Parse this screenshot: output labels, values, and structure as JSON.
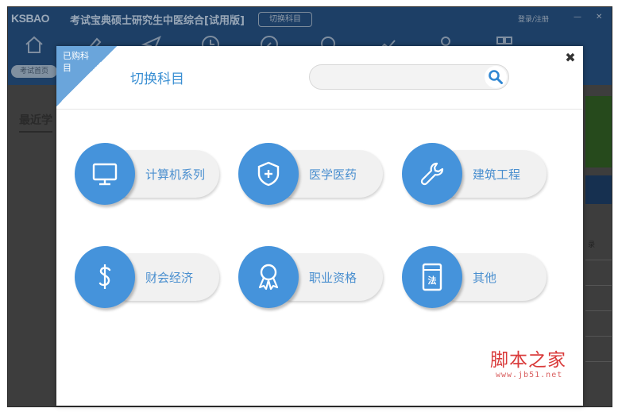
{
  "app": {
    "brand": "KSBAO",
    "brand_cn": "考试宝典",
    "title": "硕士研究生中医综合[试用版]",
    "switch_button": "切换科目",
    "login": "登录/注册",
    "home_tab": "考试首页",
    "recent_heading": "最近学",
    "right_fragment": "录"
  },
  "modal": {
    "corner_label": "已购科目",
    "title": "切换科目",
    "search": {
      "value": "",
      "placeholder": ""
    },
    "close_glyph": "✖",
    "categories": [
      {
        "label": "计算机系列",
        "icon": "monitor-icon"
      },
      {
        "label": "医学医药",
        "icon": "shield-plus-icon"
      },
      {
        "label": "建筑工程",
        "icon": "wrench-icon"
      },
      {
        "label": "财会经济",
        "icon": "dollar-icon"
      },
      {
        "label": "职业资格",
        "icon": "award-ribbon-icon"
      },
      {
        "label": "其他",
        "icon": "law-book-icon"
      }
    ],
    "icon_law_text": "法"
  },
  "watermark": {
    "cn": "脚本之家",
    "url": "www.jb51.net"
  },
  "colors": {
    "accent": "#4593db",
    "title_blue": "#3a8fd3",
    "ribbon": "#6aa5db",
    "watermark_red": "#d93a3a"
  }
}
